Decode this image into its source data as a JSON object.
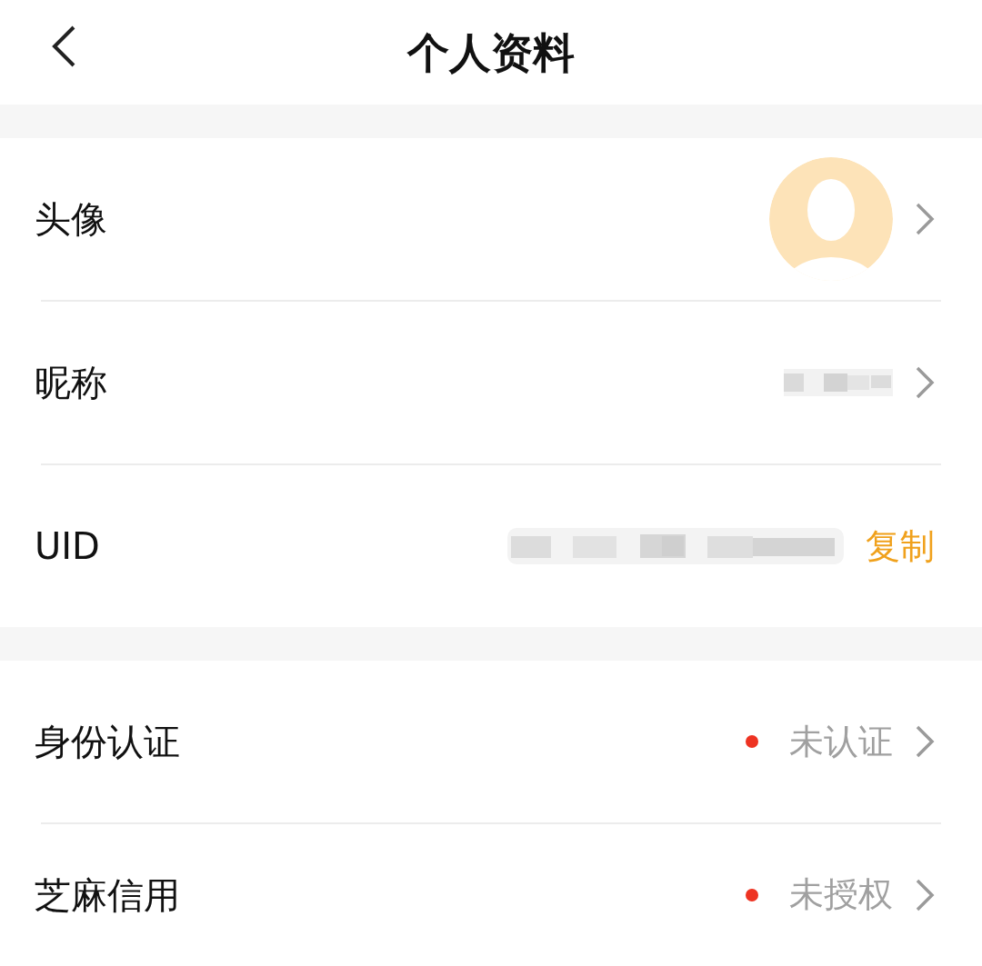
{
  "header": {
    "title": "个人资料"
  },
  "sections": [
    {
      "rows": [
        {
          "kind": "avatar",
          "label": "头像",
          "chevron": true
        },
        {
          "kind": "redacted",
          "label": "昵称",
          "chevron": true
        },
        {
          "kind": "copy",
          "label": "UID",
          "action": "复制",
          "chevron": false
        }
      ]
    },
    {
      "rows": [
        {
          "kind": "status",
          "label": "身份认证",
          "status": "未认证",
          "alert": true,
          "chevron": true
        },
        {
          "kind": "status",
          "label": "芝麻信用",
          "status": "未授权",
          "alert": true,
          "chevron": true
        }
      ]
    }
  ]
}
